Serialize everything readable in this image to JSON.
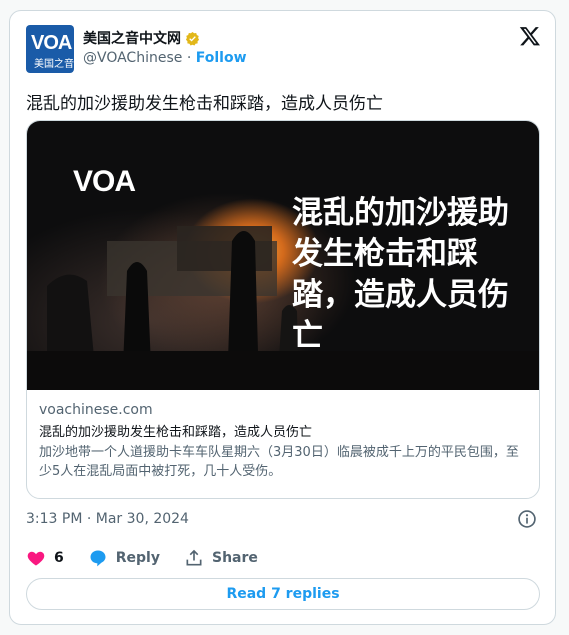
{
  "account": {
    "avatar_text": "VOA",
    "avatar_subtext": "美国之音",
    "name": "美国之音中文网",
    "handle": "@VOAChinese",
    "separator": "·",
    "follow_label": "Follow"
  },
  "tweet": {
    "text": "混乱的加沙援助发生枪击和踩踏，造成人员伤亡",
    "timestamp": "3:13 PM · Mar 30, 2024"
  },
  "card": {
    "image_logo": "VOA",
    "image_headline": "混乱的加沙援助发生枪击和踩踏，造成人员伤亡",
    "domain": "voachinese.com",
    "title": "混乱的加沙援助发生枪击和踩踏，造成人员伤亡",
    "description": "加沙地带一个人道援助卡车车队星期六（3月30日）临晨被成千上万的平民包围，至少5人在混乱局面中被打死，几十人受伤。"
  },
  "actions": {
    "like_count": "6",
    "reply_label": "Reply",
    "share_label": "Share",
    "read_replies_label": "Read 7 replies"
  },
  "colors": {
    "accent": "#1d9bf0",
    "like": "#f91880",
    "text": "#0f1419",
    "muted": "#536471"
  }
}
